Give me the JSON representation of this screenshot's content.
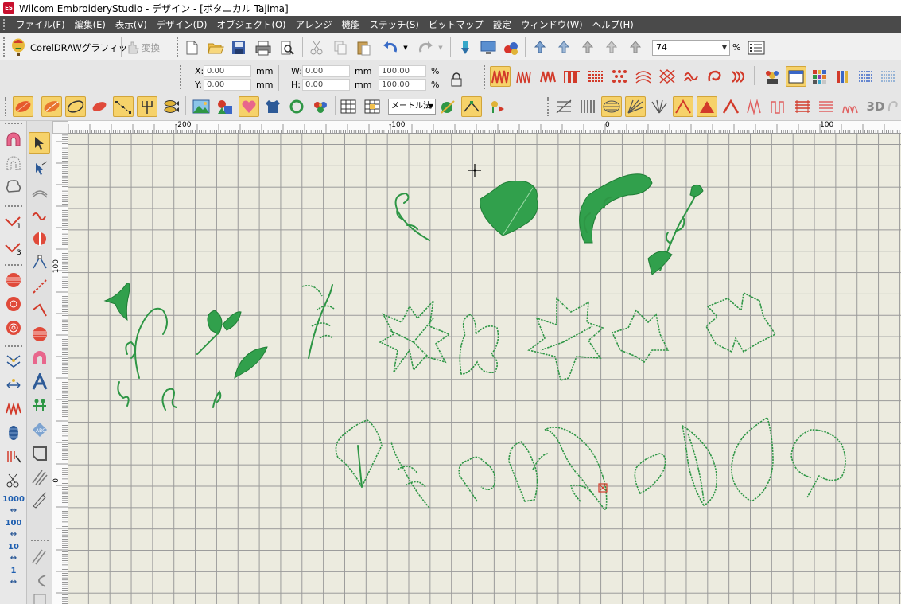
{
  "window": {
    "title": "Wilcom EmbroideryStudio - デザイン - [ボタニカル          Tajima]",
    "logo_text": "ES"
  },
  "menu": [
    {
      "label": "ファイル(F)"
    },
    {
      "label": "編集(E)"
    },
    {
      "label": "表示(V)"
    },
    {
      "label": "デザイン(D)"
    },
    {
      "label": "オブジェクト(O)"
    },
    {
      "label": "アレンジ"
    },
    {
      "label": "機能"
    },
    {
      "label": "ステッチ(S)"
    },
    {
      "label": "ビットマップ"
    },
    {
      "label": "設定"
    },
    {
      "label": "ウィンドウ(W)"
    },
    {
      "label": "ヘルプ(H)"
    }
  ],
  "toolbar": {
    "coreldraw_label": "CorelDRAWグラフィック",
    "convert_label": "変換",
    "zoom_value": "74",
    "zoom_unit": "%",
    "stitch_method": "メートル法",
    "label_3d": "3D"
  },
  "properties": {
    "x_label": "X:",
    "x_value": "0.00",
    "x_unit": "mm",
    "y_label": "Y:",
    "y_value": "0.00",
    "y_unit": "mm",
    "w_label": "W:",
    "w_value": "0.00",
    "w_unit": "mm",
    "w_pct": "100.00",
    "w_pct_unit": "%",
    "h_label": "H:",
    "h_value": "0.00",
    "h_unit": "mm",
    "h_pct": "100.00",
    "h_pct_unit": "%"
  },
  "left_toolbar": {
    "num_1000": "1000",
    "num_100": "100",
    "num_10": "10",
    "num_1": "1"
  },
  "ruler": {
    "top_labels": [
      "-200",
      "-100",
      "0",
      "100"
    ],
    "left_labels": [
      "100",
      "0"
    ]
  },
  "colors": {
    "menu_bg": "#4a4a4a",
    "canvas_bg": "#ecebdf",
    "grid": "#9a9a9a",
    "stitch_green": "#2e9645",
    "active_tool": "#f6d26a"
  }
}
